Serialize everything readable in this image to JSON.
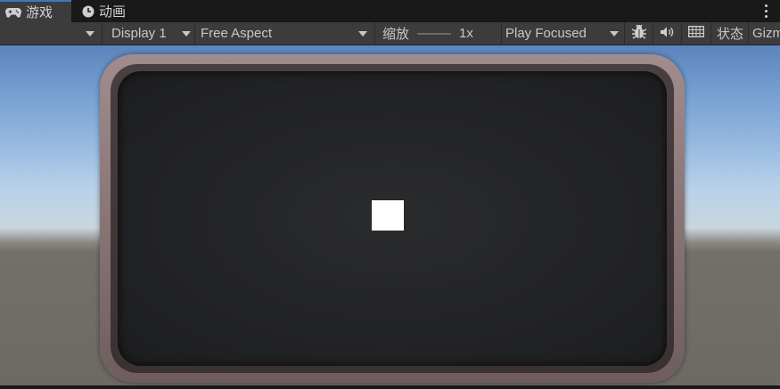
{
  "tabs": [
    {
      "label": "游戏",
      "icon": "gamepad-icon",
      "active": true
    },
    {
      "label": "动画",
      "icon": "clock-icon",
      "active": false
    }
  ],
  "toolbar": {
    "display": "Display 1",
    "aspect": "Free Aspect",
    "scale_label": "缩放",
    "scale_value": "1x",
    "play_mode": "Play Focused",
    "stats_label": "状态",
    "gizmos_label": "Gizmos"
  },
  "icons": {
    "more": "kebab-menu-icon",
    "bug": "bug-icon",
    "audio": "speaker-icon",
    "grid": "grid-icon"
  },
  "colors": {
    "accent": "#3a79bb",
    "toolbar_bg": "#3c3c3c",
    "frame": "#8a7576",
    "screen": "#222325",
    "cube": "#ffffff"
  }
}
